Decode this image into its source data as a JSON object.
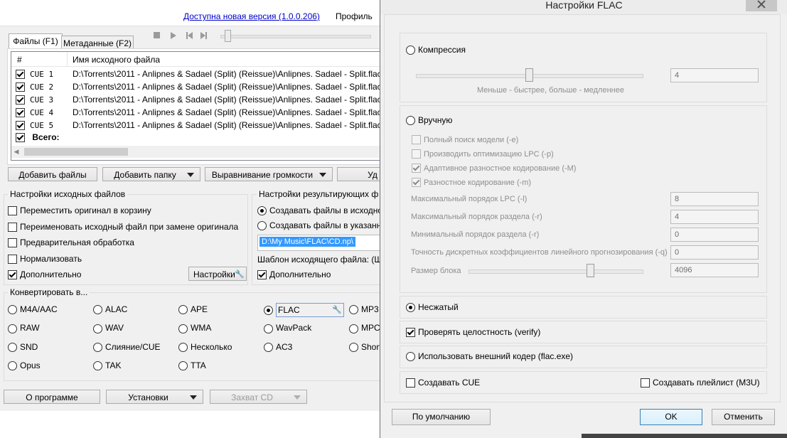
{
  "main": {
    "update_link": "Доступна новая версия (1.0.0.206)",
    "profile_label": "Профиль",
    "tabs": [
      {
        "label": "Файлы (F1)"
      },
      {
        "label": "Метаданные (F2)"
      }
    ],
    "table": {
      "columns": [
        "#",
        "Имя исходного файла"
      ],
      "rows": [
        {
          "num": "CUE 1",
          "path": "D:\\Torrents\\2011 - Anlipnes & Sadael (Split) (Reissue)\\Anlipnes. Sadael - Split.flac\\"
        },
        {
          "num": "CUE 2",
          "path": "D:\\Torrents\\2011 - Anlipnes & Sadael (Split) (Reissue)\\Anlipnes. Sadael - Split.flac\\"
        },
        {
          "num": "CUE 3",
          "path": "D:\\Torrents\\2011 - Anlipnes & Sadael (Split) (Reissue)\\Anlipnes. Sadael - Split.flac\\"
        },
        {
          "num": "CUE 4",
          "path": "D:\\Torrents\\2011 - Anlipnes & Sadael (Split) (Reissue)\\Anlipnes. Sadael - Split.flac\\"
        },
        {
          "num": "CUE 5",
          "path": "D:\\Torrents\\2011 - Anlipnes & Sadael (Split) (Reissue)\\Anlipnes. Sadael - Split.flac\\"
        }
      ],
      "total_label": "Всего:"
    },
    "buttons": {
      "add_files": "Добавить файлы",
      "add_folder": "Добавить папку",
      "normalize": "Выравнивание громкости",
      "delete_partial": "Уд"
    },
    "source_settings": {
      "title": "Настройки исходных файлов",
      "options": [
        {
          "label": "Переместить оригинал в корзину",
          "checked": false
        },
        {
          "label": "Переименовать исходный файл при замене оригинала",
          "checked": false
        },
        {
          "label": "Предварительная обработка",
          "checked": false
        },
        {
          "label": "Нормализовать",
          "checked": false
        },
        {
          "label": "Дополнительно",
          "checked": true
        }
      ],
      "settings_button": "Настройки"
    },
    "result_settings": {
      "title": "Настройки результирующих ф",
      "radio1": "Создавать файлы в исходно",
      "radio2": "Создавать файлы в указанно",
      "path": "D:\\My Music\\FLAC\\CD.np\\",
      "template_label": "Шаблон исходящего файла: (Ш",
      "extra": "Дополнительно"
    },
    "convert": {
      "title": "Конвертировать в...",
      "formats": [
        [
          "M4A/AAC",
          "ALAC",
          "APE",
          "FLAC",
          "MP3"
        ],
        [
          "RAW",
          "WAV",
          "WMA",
          "WavPack",
          "MPC"
        ],
        [
          "SND",
          "Слияние/CUE",
          "Несколько",
          "AC3",
          "Short"
        ],
        [
          "Opus",
          "TAK",
          "TTA"
        ]
      ],
      "selected": "FLAC"
    },
    "bottom": {
      "about": "О программе",
      "settings": "Установки",
      "cd_capture": "Захват CD"
    }
  },
  "dialog": {
    "title": "Настройки FLAC",
    "compression": {
      "label": "Компрессия",
      "value": "4",
      "level": 4,
      "max": 8,
      "hint": "Меньше - быстрее, больше - медленнее"
    },
    "manual": {
      "label": "Вручную",
      "checks": [
        {
          "label": "Полный поиск модели (-e)",
          "checked": false
        },
        {
          "label": "Производить оптимизацию LPC (-p)",
          "checked": false
        },
        {
          "label": "Адаптивное разностное кодирование (-M)",
          "checked": true
        },
        {
          "label": "Разностное кодирование (-m)",
          "checked": true
        }
      ],
      "fields": [
        {
          "label": "Максимальный порядок LPC (-l)",
          "value": "8"
        },
        {
          "label": "Максимальный порядок раздела (-r)",
          "value": "4"
        },
        {
          "label": "Минимальный порядок раздела (-r)",
          "value": "0"
        },
        {
          "label": "Точность дискретных коэффициентов линейного прогнозирования (-q)",
          "value": "0"
        }
      ],
      "block_label": "Размер блока",
      "block_value": "4096",
      "block_level": 0.7
    },
    "uncompressed": "Несжатый",
    "verify": "Проверять целостность (verify)",
    "external": "Использовать внешний кодер (flac.exe)",
    "create_cue": "Создавать CUE",
    "create_playlist": "Создавать плейлист (M3U)",
    "buttons": {
      "default": "По умолчанию",
      "ok": "OK",
      "cancel": "Отменить"
    }
  }
}
